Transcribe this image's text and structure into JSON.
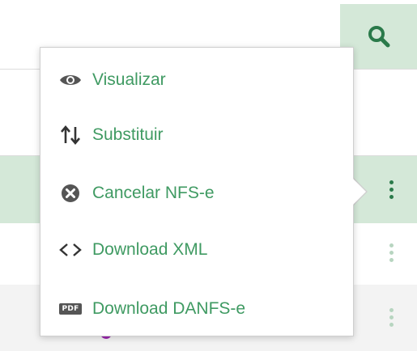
{
  "toolbar": {
    "search_icon": "search-icon",
    "accent_color": "#3f9a62",
    "selected_row_color": "#d4e8d8"
  },
  "context_menu": {
    "items": [
      {
        "label": "Visualizar",
        "icon": "eye-icon"
      },
      {
        "label": "Substituir",
        "icon": "swap-vertical-icon"
      },
      {
        "label": "Cancelar NFS-e",
        "icon": "cancel-circle-icon"
      },
      {
        "label": "Download XML",
        "icon": "code-icon"
      },
      {
        "label": "Download DANFS-e",
        "icon": "pdf-icon",
        "badge_text": "PDF"
      }
    ]
  },
  "rows": [
    {
      "state": "selected",
      "actions_icon": "kebab-menu-icon"
    },
    {
      "state": "normal",
      "actions_icon": "kebab-menu-icon"
    },
    {
      "state": "normal",
      "actions_icon": "kebab-menu-icon"
    }
  ]
}
